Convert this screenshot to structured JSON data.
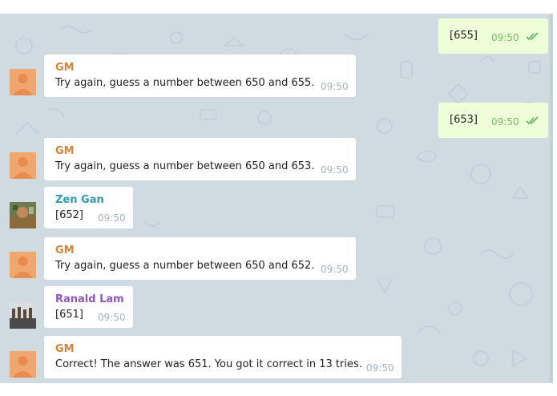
{
  "colors": {
    "chat_background": "#cfdbe1",
    "incoming_bubble": "#ffffff",
    "outgoing_bubble": "#eefed9",
    "sender_gm": "#d2843a",
    "sender_zen": "#2f9ab0",
    "sender_ronald": "#8e55c0",
    "read_ticks": "#5fb35a"
  },
  "messages": [
    {
      "direction": "out",
      "text": "[655]",
      "time": "09:50",
      "status": "read-double-check-icon"
    },
    {
      "direction": "in",
      "sender": "GM",
      "avatar": "default-orange-person-icon",
      "text": "Try again, guess a number between 650 and 655.",
      "time": "09:50"
    },
    {
      "direction": "out",
      "text": "[653]",
      "time": "09:50",
      "status": "read-double-check-icon"
    },
    {
      "direction": "in",
      "sender": "GM",
      "avatar": "default-orange-person-icon",
      "text": "Try again, guess a number between 650 and 653.",
      "time": "09:50"
    },
    {
      "direction": "in",
      "sender": "Zen Gan",
      "avatar": "photo-avatar",
      "text": "[652]",
      "time": "09:50"
    },
    {
      "direction": "in",
      "sender": "GM",
      "avatar": "default-orange-person-icon",
      "text": "Try again, guess a number between 650 and 652.",
      "time": "09:50"
    },
    {
      "direction": "in",
      "sender": "Ranald Lam",
      "avatar": "photo-avatar",
      "text": "[651]",
      "time": "09:50"
    },
    {
      "direction": "in",
      "sender": "GM",
      "avatar": "default-orange-person-icon",
      "text": "Correct! The answer was 651. You got it correct in 13 tries.",
      "time": "09:50"
    }
  ]
}
